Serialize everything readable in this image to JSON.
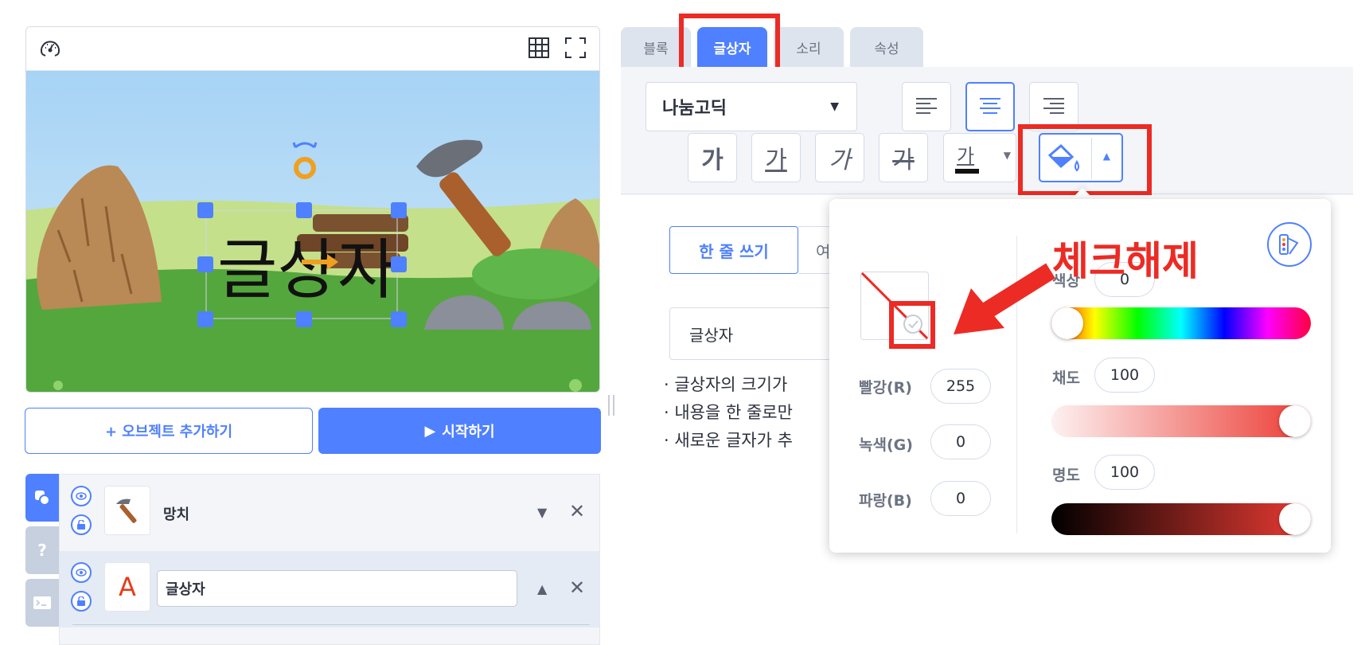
{
  "stage": {
    "canvas_text": "글상자"
  },
  "buttons": {
    "add_object": "+ 오브젝트 추가하기",
    "start": "시작하기",
    "start_icon": "play-icon"
  },
  "objects": [
    {
      "name": "망치",
      "arrow": "▼",
      "close": "✕",
      "thumb_icon": "hammer-icon"
    },
    {
      "name": "글상자",
      "arrow": "▲",
      "close": "✕",
      "thumb_letter": "A"
    }
  ],
  "side_tabs": [
    {
      "icon": "object-icon"
    },
    {
      "label": "?"
    },
    {
      "icon": "console-icon"
    }
  ],
  "tabs": [
    {
      "label": "블록"
    },
    {
      "label": "글상자"
    },
    {
      "label": "소리"
    },
    {
      "label": "속성"
    }
  ],
  "toolbar": {
    "font": "나눔고딕",
    "font_caret": "▼",
    "style_buttons": [
      "가",
      "가",
      "가",
      "가",
      "가"
    ],
    "color_caret": "▼",
    "fill_caret": "▲"
  },
  "content": {
    "mode_single": "한 줄 쓰기",
    "mode_multi_partial": "여",
    "text_value": "글상자",
    "help_lines": [
      "· 글상자의 크기가",
      "· 내용을 한 줄로만",
      "· 새로운 글자가 추"
    ]
  },
  "color_popup": {
    "rgb": [
      {
        "label": "빨강(R)",
        "value": "255"
      },
      {
        "label": "녹색(G)",
        "value": "0"
      },
      {
        "label": "파랑(B)",
        "value": "0"
      }
    ],
    "hsv": [
      {
        "label": "색상",
        "value": "0"
      },
      {
        "label": "채도",
        "value": "100"
      },
      {
        "label": "명도",
        "value": "100"
      }
    ],
    "hue_position": 0.0,
    "saturation_position": 1.0,
    "brightness_position": 1.0,
    "accent": "#4f80ff"
  },
  "annotation": {
    "text": "체크해제",
    "color": "#ec2b24"
  }
}
